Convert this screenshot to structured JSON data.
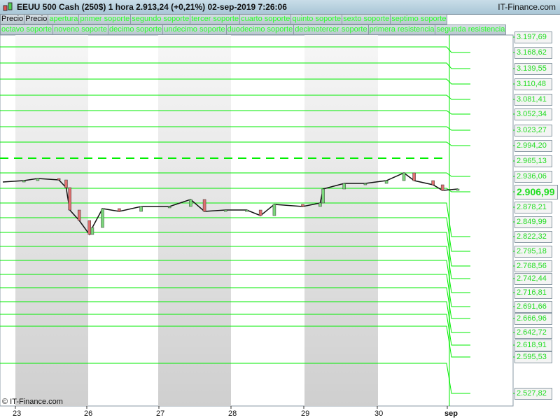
{
  "header": {
    "title": "EEUU 500 Cash (250$)   1 hora   2.913,24 (+0,21%)   02-sep-2019 7:26:06",
    "brand": "IT-Finance.com"
  },
  "legend_row1": [
    "Precio",
    "Precio",
    "apertura",
    "primer soporte",
    "segundo soporte",
    "tercer soporte",
    "cuarto soporte",
    "quinto soporte",
    "sexto soporte",
    "septimo soporte"
  ],
  "legend_row2": [
    "octavo soporte",
    "noveno soporte",
    "decimo soporte",
    "undecimo soporte",
    "duodecimo soporte",
    "decimotercer soporte",
    "primera resistencia",
    "segunda resistencia"
  ],
  "copyright": "© IT-Finance.com",
  "colors": {
    "level": "#00ee00",
    "up": "#7bd87b",
    "down": "#e07070",
    "band": "#d0d0d0"
  },
  "chart_data": {
    "type": "line",
    "title": "EEUU 500 Cash (250$) 1 hora",
    "x_ticks": [
      "23",
      "26",
      "27",
      "28",
      "29",
      "30",
      "sep"
    ],
    "current_price": "2.906,99",
    "price_labels": [
      "3.197,69",
      "3.168,62",
      "3.139,55",
      "3.110,48",
      "3.081,41",
      "3.052,34",
      "3.023,27",
      "2.994,20",
      "2.965,13",
      "2.936,06",
      "2.906,99",
      "2.878,21",
      "2.849,99",
      "2.822,32",
      "2.795,18",
      "2.768,56",
      "2.742,44",
      "2.716,81",
      "2.691,66",
      "2.666,96",
      "2.642,72",
      "2.618,91",
      "2.595,53",
      "2.527,82"
    ],
    "price_series": [
      2925.5,
      2928.1,
      2932.1,
      2929.4,
      2914.9,
      2872.6,
      2852.8,
      2826.4,
      2839.6,
      2875.3,
      2870.0,
      2879.3,
      2879.3,
      2892.5,
      2870.0,
      2872.6,
      2872.6,
      2862.1,
      2883.2,
      2879.3,
      2885.9,
      2912.3,
      2922.8,
      2922.8,
      2928.1,
      2942.7,
      2928.1,
      2920.2,
      2909.6,
      2912.3
    ],
    "series_day_offsets": [
      0,
      0.29,
      0.48,
      0.77,
      0.87,
      0.92,
      1.05,
      1.19,
      1.23,
      1.37,
      1.6,
      1.9,
      2.29,
      2.58,
      2.77,
      3.06,
      3.35,
      3.54,
      3.73,
      4.12,
      4.36,
      4.4,
      4.69,
      4.98,
      5.27,
      5.51,
      5.65,
      5.91,
      6.04,
      6.25
    ]
  }
}
